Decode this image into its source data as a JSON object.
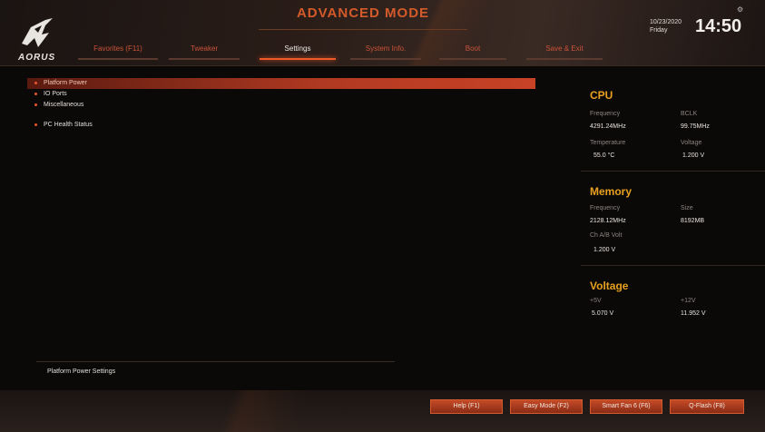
{
  "header": {
    "mode_title": "ADVANCED MODE",
    "logo_text": "AORUS",
    "tabs": [
      {
        "label": "Favorites (F11)"
      },
      {
        "label": "Tweaker"
      },
      {
        "label": "Settings"
      },
      {
        "label": "System Info."
      },
      {
        "label": "Boot"
      },
      {
        "label": "Save & Exit"
      }
    ],
    "active_tab": "Settings",
    "date": "10/23/2020",
    "day": "Friday",
    "time": "14:50"
  },
  "menu": {
    "items": [
      {
        "label": "Platform Power"
      },
      {
        "label": "IO Ports"
      },
      {
        "label": "Miscellaneous"
      },
      {
        "label": "PC Health Status"
      }
    ],
    "selected": "Platform Power"
  },
  "help": {
    "text": "Platform Power Settings"
  },
  "panel": {
    "cpu": {
      "title": "CPU",
      "frequency_label": "Frequency",
      "frequency": "4291.24MHz",
      "bclk_label": "BCLK",
      "bclk": "99.75MHz",
      "temperature_label": "Temperature",
      "temperature": "55.0 °C",
      "voltage_label": "Voltage",
      "voltage": "1.200 V"
    },
    "memory": {
      "title": "Memory",
      "frequency_label": "Frequency",
      "frequency": "2128.12MHz",
      "size_label": "Size",
      "size": "8192MB",
      "volt_label": "Ch A/B Volt",
      "volt": "1.200 V"
    },
    "voltage": {
      "title": "Voltage",
      "v5_label": "+5V",
      "v5": "5.070 V",
      "v12_label": "+12V",
      "v12": "11.952 V"
    }
  },
  "footer": {
    "buttons": [
      {
        "label": "Help (F1)"
      },
      {
        "label": "Easy Mode (F2)"
      },
      {
        "label": "Smart Fan 6 (F6)"
      },
      {
        "label": "Q-Flash (F8)"
      }
    ]
  },
  "colors": {
    "accent": "#e8562a",
    "section_title": "#e8a020",
    "background": "#0b0908"
  }
}
